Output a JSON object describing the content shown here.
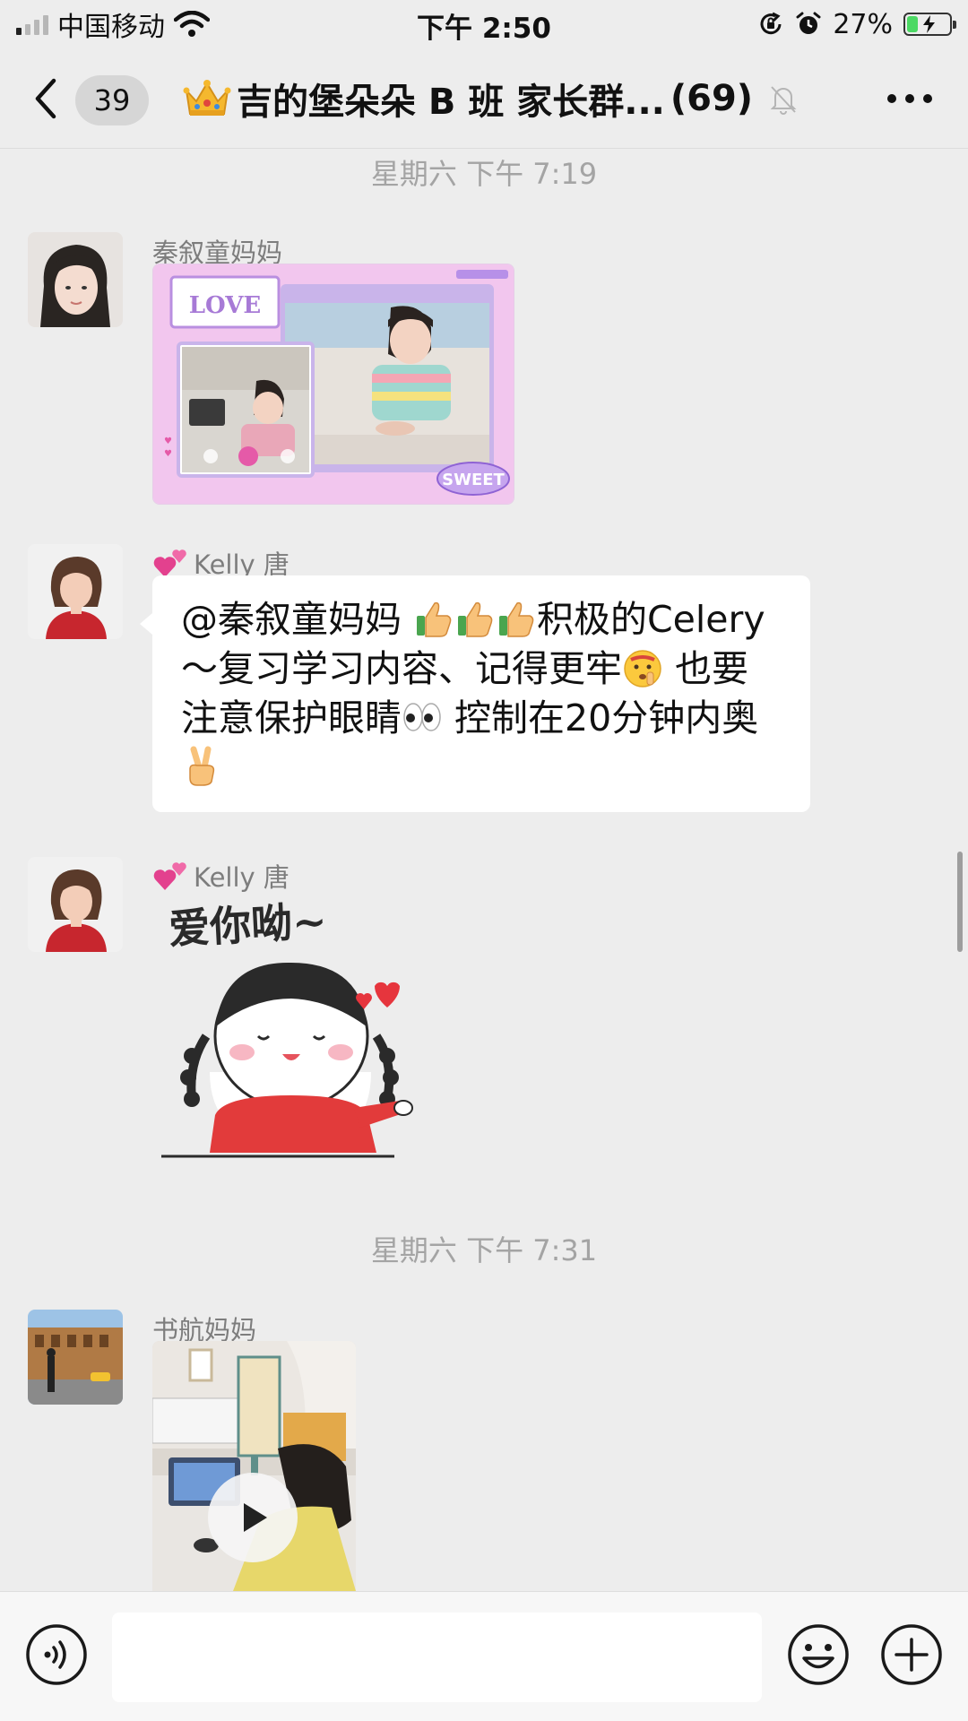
{
  "status_bar": {
    "carrier": "中国移动",
    "time": "下午 2:50",
    "battery_percent": "27%",
    "battery_level": 0.27,
    "icons": [
      "signal-icon",
      "wifi-icon",
      "orientation-lock-icon",
      "alarm-icon",
      "battery-icon"
    ]
  },
  "nav": {
    "unread_count": "39",
    "title": "吉的堡朵朵 B 班 家长群...",
    "member_count": "(69)",
    "icons": [
      "back-icon",
      "crown-icon",
      "mute-bell-icon",
      "more-icon"
    ]
  },
  "chat": {
    "timestamps": [
      "星期六 下午 7:19",
      "星期六 下午 7:31"
    ],
    "messages": [
      {
        "sender": "秦叙童妈妈",
        "type": "image",
        "image_text": [
          "LOVE",
          "SWEET"
        ]
      },
      {
        "sender": "Kelly 唐",
        "type": "text",
        "segments": {
          "p1": "@秦叙童妈妈 ",
          "p2": "积极的Celery～复习学习内容、记得更牢",
          "p3": " 也要注意保护眼睛",
          "p4": " 控制在20分钟内奥"
        },
        "emoji": [
          "thumbs-up",
          "thumbs-up",
          "thumbs-up",
          "shushing-face",
          "eyes",
          "victory-hand"
        ]
      },
      {
        "sender": "Kelly 唐",
        "type": "sticker",
        "sticker_text": "爱你呦~"
      },
      {
        "sender": "书航妈妈",
        "type": "video"
      }
    ]
  },
  "input_bar": {
    "text": "",
    "icons": [
      "voice-icon",
      "emoji-icon",
      "plus-icon"
    ]
  },
  "colors": {
    "background": "#ededed",
    "bubble": "#ffffff",
    "timestamp": "#a4a4a4",
    "sender": "#7d7d7d",
    "battery_green": "#4cd964"
  }
}
